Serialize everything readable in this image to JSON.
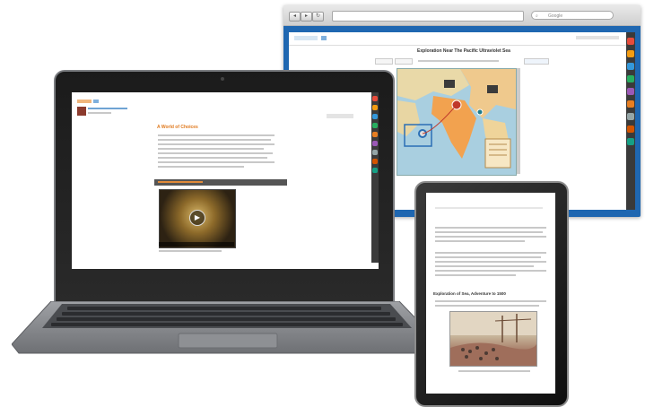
{
  "scene": "Laptop, desktop browser and tablet displaying digital textbook content",
  "browser": {
    "search_placeholder": "Google",
    "map_title": "Exploration Near The Pacific Ultraviolet Sea"
  },
  "laptop": {
    "heading": "A World of Choices"
  },
  "tablet": {
    "heading": "Exploration of Sea, Adventure to 1500"
  },
  "colors": {
    "browser_frame": "#1f67b1",
    "accent_orange": "#e07a1f",
    "device_black": "#1b1b1b"
  },
  "icons": [
    "play-icon",
    "back-icon",
    "forward-icon",
    "reload-icon",
    "search-icon"
  ]
}
